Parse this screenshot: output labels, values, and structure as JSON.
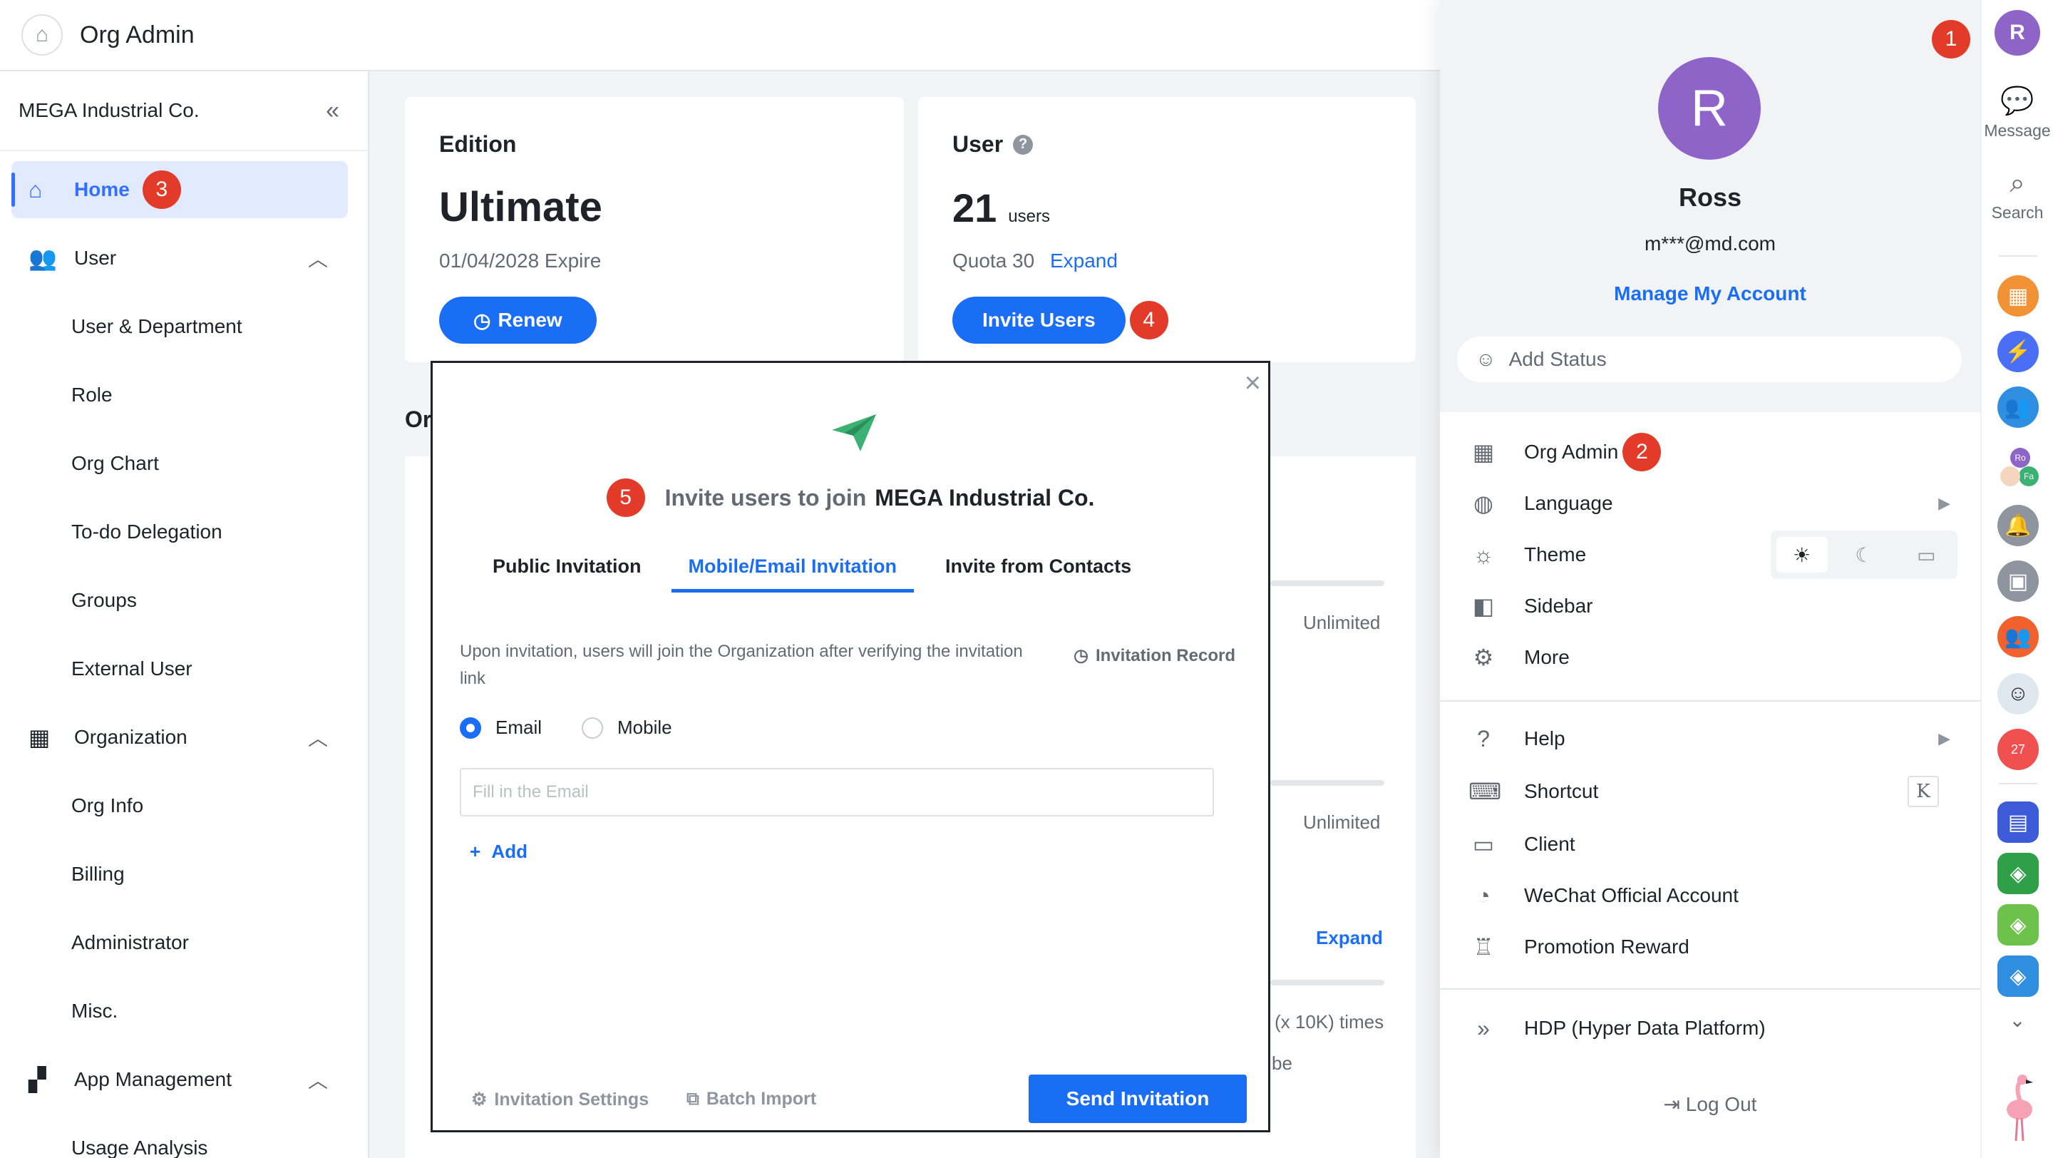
{
  "topbar": {
    "title": "Org Admin"
  },
  "sidebar": {
    "org_name": "MEGA Industrial Co.",
    "items": [
      {
        "label": "Home",
        "badge": "3"
      },
      {
        "label": "User"
      },
      {
        "label": "User & Department"
      },
      {
        "label": "Role"
      },
      {
        "label": "Org Chart"
      },
      {
        "label": "To-do Delegation"
      },
      {
        "label": "Groups"
      },
      {
        "label": "External User"
      },
      {
        "label": "Organization"
      },
      {
        "label": "Org Info"
      },
      {
        "label": "Billing"
      },
      {
        "label": "Administrator"
      },
      {
        "label": "Misc."
      },
      {
        "label": "App Management"
      },
      {
        "label": "Usage Analysis"
      }
    ]
  },
  "edition_card": {
    "label": "Edition",
    "value": "Ultimate",
    "expire": "01/04/2028 Expire",
    "renew_label": "Renew"
  },
  "user_card": {
    "label": "User",
    "count": "21",
    "unit": "users",
    "quota": "Quota 30",
    "expand_label": "Expand",
    "invite_label": "Invite Users",
    "badge": "4"
  },
  "background": {
    "section_title": "Or",
    "unlimited_1": "Unlimited",
    "unlimited_2": "Unlimited",
    "expand": "Expand",
    "times": "(x 10K) times",
    "be": "be"
  },
  "dialog": {
    "badge": "5",
    "title_prefix": "Invite users to join",
    "title_org": "MEGA Industrial Co.",
    "tabs": [
      "Public Invitation",
      "Mobile/Email Invitation",
      "Invite from Contacts"
    ],
    "description": "Upon invitation, users will join the Organization after verifying the invitation link",
    "record_label": "Invitation Record",
    "radio_email": "Email",
    "radio_mobile": "Mobile",
    "email_placeholder": "Fill in the Email",
    "add_label": "Add",
    "settings_label": "Invitation Settings",
    "batch_label": "Batch Import",
    "send_label": "Send Invitation"
  },
  "profile": {
    "avatar_letter": "R",
    "name": "Ross",
    "email": "m***@md.com",
    "manage_label": "Manage My Account",
    "status_placeholder": "Add Status",
    "badge_top": "1",
    "menu": [
      {
        "label": "Org Admin",
        "badge": "2"
      },
      {
        "label": "Language"
      },
      {
        "label": "Theme"
      },
      {
        "label": "Sidebar"
      },
      {
        "label": "More"
      },
      {
        "label": "Help"
      },
      {
        "label": "Shortcut",
        "key": "K"
      },
      {
        "label": "Client"
      },
      {
        "label": "WeChat Official Account"
      },
      {
        "label": "Promotion Reward"
      },
      {
        "label": "HDP (Hyper Data Platform)"
      }
    ],
    "logout_label": "Log Out"
  },
  "dock": {
    "avatar_letter": "R",
    "message_label": "Message",
    "search_label": "Search",
    "mini_avatar_1": "Ro",
    "mini_avatar_2": "Fa",
    "calendar_day": "27"
  },
  "colors": {
    "accent": "#1a6ef6",
    "badge": "#e23b2a",
    "avatar": "#8e64c8"
  }
}
